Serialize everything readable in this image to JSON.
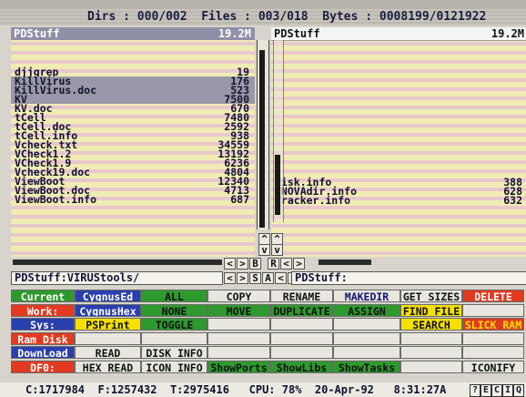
{
  "status": {
    "text": "Dirs : 000/002  Files : 003/018  Bytes : 0008199/0121922"
  },
  "left_panel": {
    "path": "PDStuff",
    "size": "19.2M",
    "rows": [
      {
        "name": "",
        "size": "",
        "state": "faint"
      },
      {
        "name": "",
        "size": "",
        "state": "faint"
      },
      {
        "name": "",
        "size": "",
        "state": "faint"
      },
      {
        "name": "djjgrep",
        "size": "19",
        "state": ""
      },
      {
        "name": "KillVirus",
        "size": "176",
        "state": "sel"
      },
      {
        "name": "KillVirus.doc",
        "size": "523",
        "state": "sel"
      },
      {
        "name": "KV",
        "size": "7500",
        "state": "sel"
      },
      {
        "name": "KV.doc",
        "size": "670",
        "state": ""
      },
      {
        "name": "tCell",
        "size": "7480",
        "state": ""
      },
      {
        "name": "tCell.doc",
        "size": "2592",
        "state": ""
      },
      {
        "name": "tCell.info",
        "size": "938",
        "state": ""
      },
      {
        "name": "Vcheck.txt",
        "size": "34559",
        "state": ""
      },
      {
        "name": "VCheck1.2",
        "size": "13192",
        "state": ""
      },
      {
        "name": "VCheck1.9",
        "size": "6236",
        "state": ""
      },
      {
        "name": "Vcheck19.doc",
        "size": "4804",
        "state": ""
      },
      {
        "name": "ViewBoot",
        "size": "12340",
        "state": ""
      },
      {
        "name": "ViewBoot.doc",
        "size": "4713",
        "state": ""
      },
      {
        "name": "ViewBoot.info",
        "size": "687",
        "state": ""
      }
    ]
  },
  "right_panel": {
    "path": "PDStuff",
    "size": "19.2M",
    "rows": [
      {
        "name": "",
        "size": "",
        "state": "faint"
      },
      {
        "name": "",
        "size": "",
        "state": "faint"
      },
      {
        "name": "",
        "size": "",
        "state": "faint"
      },
      {
        "name": "",
        "size": "",
        "state": "faint"
      },
      {
        "name": "",
        "size": "",
        "state": "faint"
      },
      {
        "name": "",
        "size": "",
        "state": "faint"
      },
      {
        "name": "",
        "size": "",
        "state": "faint"
      },
      {
        "name": "",
        "size": "",
        "state": "faint"
      },
      {
        "name": "",
        "size": "",
        "state": "faint"
      },
      {
        "name": "",
        "size": "",
        "state": "faint"
      },
      {
        "name": "",
        "size": "",
        "state": "faint"
      },
      {
        "name": "",
        "size": "",
        "state": "faint"
      },
      {
        "name": "",
        "size": "",
        "state": "faint"
      },
      {
        "name": "",
        "size": "",
        "state": "faint"
      },
      {
        "name": "",
        "size": "",
        "state": "faint"
      },
      {
        "name": "disk.info",
        "size": "388",
        "state": ""
      },
      {
        "name": "INOVAdir.info",
        "size": "628",
        "state": ""
      },
      {
        "name": "Tracker.info",
        "size": "632",
        "state": ""
      }
    ]
  },
  "left_path": "PDStuff:VIRUStools/",
  "right_path": "PDStuff:",
  "mid_controls": {
    "b": "B",
    "r": "R",
    "s": "S",
    "a": "A"
  },
  "arrows": {
    "up": "^",
    "down": "v",
    "left": "<",
    "right": ">"
  },
  "buttons": [
    [
      {
        "label": "Current",
        "bg": "#2e9a2e",
        "fg": "#ffffff"
      },
      {
        "label": "CygnusEd",
        "bg": "#2a3fae",
        "fg": "#ffffff"
      },
      {
        "label": "ALL",
        "bg": "#2e9a2e",
        "fg": "#111111"
      },
      {
        "label": "COPY",
        "bg": "#e8e6de",
        "fg": "#111111"
      },
      {
        "label": "RENAME",
        "bg": "#e8e6de",
        "fg": "#111111"
      },
      {
        "label": "MAKEDIR",
        "bg": "#e8e6de",
        "fg": "#14147a"
      },
      {
        "label": "GET SIZES",
        "bg": "#e8e6de",
        "fg": "#111111"
      },
      {
        "label": "DELETE",
        "bg": "#e23a20",
        "fg": "#ffffff"
      }
    ],
    [
      {
        "label": "Work:",
        "bg": "#e23a20",
        "fg": "#ffffff"
      },
      {
        "label": "CygnusHex",
        "bg": "#2a3fae",
        "fg": "#ffffff"
      },
      {
        "label": "NONE",
        "bg": "#2e9a2e",
        "fg": "#111111"
      },
      {
        "label": "MOVE",
        "bg": "#2e9a2e",
        "fg": "#111111"
      },
      {
        "label": "DUPLICATE",
        "bg": "#2e9a2e",
        "fg": "#111111"
      },
      {
        "label": "ASSIGN",
        "bg": "#2e9a2e",
        "fg": "#111111"
      },
      {
        "label": "FIND FILE",
        "bg": "#f5e000",
        "fg": "#111111"
      },
      {
        "label": "",
        "bg": "#e8e6de",
        "fg": "#111111"
      }
    ],
    [
      {
        "label": "Sys:",
        "bg": "#2a3fae",
        "fg": "#ffffff"
      },
      {
        "label": "PSPrint",
        "bg": "#f5e000",
        "fg": "#111111"
      },
      {
        "label": "TOGGLE",
        "bg": "#2e9a2e",
        "fg": "#111111"
      },
      {
        "label": "",
        "bg": "#e8e6de",
        "fg": "#111111"
      },
      {
        "label": "",
        "bg": "#e8e6de",
        "fg": "#111111"
      },
      {
        "label": "",
        "bg": "#e8e6de",
        "fg": "#111111"
      },
      {
        "label": "SEARCH",
        "bg": "#f5e000",
        "fg": "#111111"
      },
      {
        "label": "SLICK RAM",
        "bg": "#e23a20",
        "fg": "#f5e000"
      }
    ],
    [
      {
        "label": "Ram Disk",
        "bg": "#e23a20",
        "fg": "#ffffff"
      },
      {
        "label": "",
        "bg": "#e8e6de",
        "fg": "#111111"
      },
      {
        "label": "",
        "bg": "#e8e6de",
        "fg": "#111111"
      },
      {
        "label": "",
        "bg": "#e8e6de",
        "fg": "#111111"
      },
      {
        "label": "",
        "bg": "#e8e6de",
        "fg": "#111111"
      },
      {
        "label": "",
        "bg": "#e8e6de",
        "fg": "#111111"
      },
      {
        "label": "",
        "bg": "#e8e6de",
        "fg": "#111111"
      },
      {
        "label": "",
        "bg": "#e8e6de",
        "fg": "#111111"
      }
    ],
    [
      {
        "label": "DownLoad",
        "bg": "#2a3fae",
        "fg": "#ffffff"
      },
      {
        "label": "READ",
        "bg": "#e8e6de",
        "fg": "#111111"
      },
      {
        "label": "DISK INFO",
        "bg": "#e8e6de",
        "fg": "#111111"
      },
      {
        "label": "",
        "bg": "#e8e6de",
        "fg": "#111111"
      },
      {
        "label": "",
        "bg": "#e8e6de",
        "fg": "#111111"
      },
      {
        "label": "",
        "bg": "#e8e6de",
        "fg": "#111111"
      },
      {
        "label": "",
        "bg": "#e8e6de",
        "fg": "#111111"
      },
      {
        "label": "",
        "bg": "#e8e6de",
        "fg": "#111111"
      }
    ],
    [
      {
        "label": "DF0:",
        "bg": "#e23a20",
        "fg": "#ffffff"
      },
      {
        "label": "HEX READ",
        "bg": "#e8e6de",
        "fg": "#111111"
      },
      {
        "label": "ICON INFO",
        "bg": "#e8e6de",
        "fg": "#111111"
      },
      {
        "label": "ShowPorts",
        "bg": "#2e9a2e",
        "fg": "#111111"
      },
      {
        "label": "ShowLibs",
        "bg": "#2e9a2e",
        "fg": "#111111"
      },
      {
        "label": "ShowTasks",
        "bg": "#2e9a2e",
        "fg": "#111111"
      },
      {
        "label": "",
        "bg": "#e8e6de",
        "fg": "#111111"
      },
      {
        "label": "ICONIFY",
        "bg": "#e8e6de",
        "fg": "#111111"
      }
    ]
  ],
  "bottom": {
    "text": "C:1717984  F:1257432  T:2975416   CPU: 78%  20-Apr-92   8:31:27A",
    "buttons": [
      "?",
      "E",
      "C",
      "I",
      "Q"
    ]
  }
}
